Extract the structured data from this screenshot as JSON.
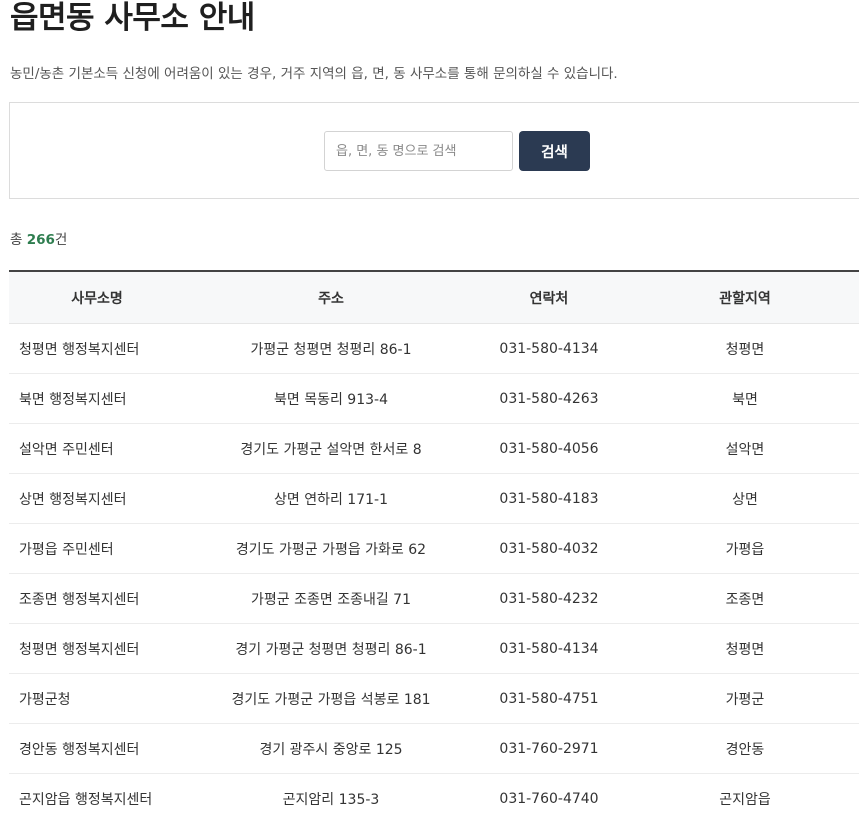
{
  "page": {
    "title": "읍면동 사무소 안내",
    "description": "농민/농촌 기본소득 신청에 어려움이 있는 경우, 거주 지역의 읍, 면, 동 사무소를 통해 문의하실 수 있습니다."
  },
  "search": {
    "placeholder": "읍, 면, 동 명으로 검색",
    "value": "",
    "button_label": "검색"
  },
  "result": {
    "prefix": "총 ",
    "count": "266",
    "suffix": "건"
  },
  "table": {
    "headers": [
      "사무소명",
      "주소",
      "연락처",
      "관할지역"
    ],
    "rows": [
      [
        "청평면 행정복지센터",
        "가평군 청평면 청평리 86-1",
        "031-580-4134",
        "청평면"
      ],
      [
        "북면 행정복지센터",
        "북면 목동리 913-4",
        "031-580-4263",
        "북면"
      ],
      [
        "설악면 주민센터",
        "경기도 가평군 설악면 한서로 8",
        "031-580-4056",
        "설악면"
      ],
      [
        "상면 행정복지센터",
        "상면 연하리 171-1",
        "031-580-4183",
        "상면"
      ],
      [
        "가평읍 주민센터",
        "경기도 가평군 가평읍 가화로 62",
        "031-580-4032",
        "가평읍"
      ],
      [
        "조종면 행정복지센터",
        "가평군 조종면 조종내길 71",
        "031-580-4232",
        "조종면"
      ],
      [
        "청평면 행정복지센터",
        "경기 가평군 청평면 청평리 86-1",
        "031-580-4134",
        "청평면"
      ],
      [
        "가평군청",
        "경기도 가평군 가평읍 석봉로 181",
        "031-580-4751",
        "가평군"
      ],
      [
        "경안동 행정복지센터",
        "경기 광주시 중앙로 125",
        "031-760-2971",
        "경안동"
      ],
      [
        "곤지암읍 행정복지센터",
        "곤지암리 135-3",
        "031-760-4740",
        "곤지암읍"
      ]
    ]
  },
  "colors": {
    "button_bg": "#2b3a52",
    "count_accent": "#2e7d4f",
    "table_top_border": "#444444"
  }
}
